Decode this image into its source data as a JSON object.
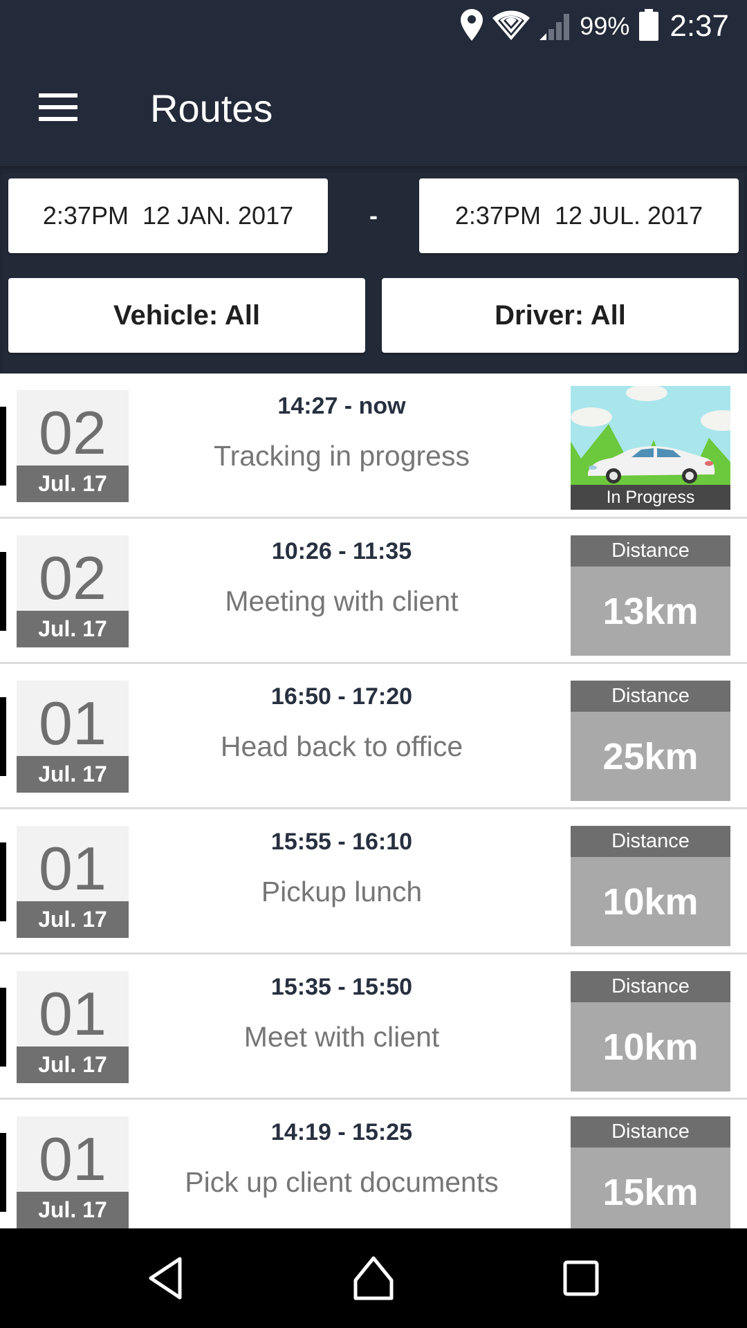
{
  "status_bar": {
    "icons": [
      "location-icon",
      "wifi-icon",
      "cell-signal-icon",
      "battery-icon"
    ],
    "battery": "99%",
    "time": "2:37"
  },
  "toolbar": {
    "menu_icon": "hamburger-menu-icon",
    "title": "Routes"
  },
  "filters": {
    "date_from": "2:37PM  12 JAN. 2017",
    "separator": "-",
    "date_to": "2:37PM  12 JUL. 2017",
    "vehicle": "Vehicle: All",
    "driver": "Driver: All"
  },
  "routes": [
    {
      "day": "02",
      "month": "Jul. 17",
      "time": "14:27 - now",
      "description": "Tracking in progress",
      "status": "In Progress",
      "in_progress": true
    },
    {
      "day": "02",
      "month": "Jul. 17",
      "time": "10:26 - 11:35",
      "description": "Meeting with client",
      "distance_label": "Distance",
      "distance": "13km"
    },
    {
      "day": "01",
      "month": "Jul. 17",
      "time": "16:50 - 17:20",
      "description": "Head back to office",
      "distance_label": "Distance",
      "distance": "25km"
    },
    {
      "day": "01",
      "month": "Jul. 17",
      "time": "15:55 - 16:10",
      "description": "Pickup lunch",
      "distance_label": "Distance",
      "distance": "10km"
    },
    {
      "day": "01",
      "month": "Jul. 17",
      "time": "15:35 - 15:50",
      "description": "Meet with client",
      "distance_label": "Distance",
      "distance": "10km"
    },
    {
      "day": "01",
      "month": "Jul. 17",
      "time": "14:19 - 15:25",
      "description": "Pick up client documents",
      "distance_label": "Distance",
      "distance": "15km"
    }
  ],
  "nav_bar": {
    "icons": [
      "back-icon",
      "home-icon",
      "recent-apps-icon"
    ]
  },
  "colors": {
    "header": "#232a39",
    "day_text": "#6f6f6f",
    "month_band": "#707070",
    "time_text": "#27303f",
    "description_text": "#767676",
    "distance_label_bg": "#6e6e6e",
    "distance_value_bg": "#a9a9a9"
  }
}
